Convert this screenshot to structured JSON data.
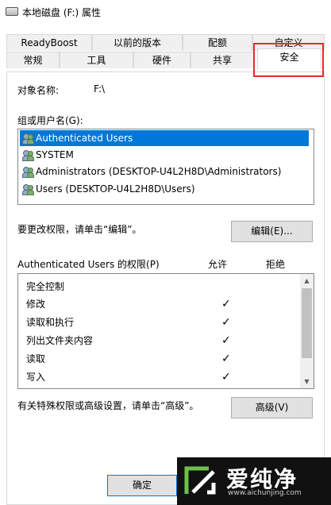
{
  "window": {
    "title": "本地磁盘 (F:) 属性"
  },
  "tabs_back": [
    {
      "label": "ReadyBoost"
    },
    {
      "label": "以前的版本"
    },
    {
      "label": "配额"
    },
    {
      "label": "自定义"
    }
  ],
  "tabs_front": [
    {
      "label": "常规"
    },
    {
      "label": "工具"
    },
    {
      "label": "硬件"
    },
    {
      "label": "共享"
    },
    {
      "label": "安全"
    }
  ],
  "security": {
    "object_label": "对象名称:",
    "object_value": "F:\\",
    "groups_label": "组或用户名(G):",
    "users": [
      {
        "name": "Authenticated Users"
      },
      {
        "name": "SYSTEM"
      },
      {
        "name": "Administrators (DESKTOP-U4L2H8D\\Administrators)"
      },
      {
        "name": "Users (DESKTOP-U4L2H8D\\Users)"
      }
    ],
    "change_text": "要更改权限，请单击“编辑”。",
    "edit_button": "编辑(E)...",
    "perm_header": "Authenticated Users 的权限(P)",
    "allow_header": "允许",
    "deny_header": "拒绝",
    "permissions": [
      {
        "name": "完全控制",
        "allow": ""
      },
      {
        "name": "修改",
        "allow": "✓"
      },
      {
        "name": "读取和执行",
        "allow": "✓"
      },
      {
        "name": "列出文件夹内容",
        "allow": "✓"
      },
      {
        "name": "读取",
        "allow": "✓"
      },
      {
        "name": "写入",
        "allow": "✓"
      }
    ],
    "advanced_text": "有关特殊权限或高级设置，请单击“高级”。",
    "advanced_button": "高级(V)"
  },
  "footer": {
    "ok_button": "确定"
  },
  "watermark": {
    "brand": "爱纯净",
    "url": "www.aichunjing.com"
  },
  "colors": {
    "selection": "#0078d7",
    "highlight_box": "#e0302a"
  }
}
